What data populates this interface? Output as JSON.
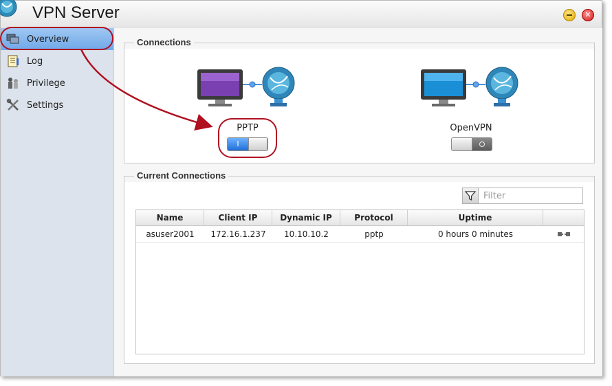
{
  "window": {
    "title": "VPN Server",
    "controls": {
      "minimize_icon": "minimize-icon",
      "close_icon": "close-icon",
      "close_glyph": "✕"
    }
  },
  "sidebar": {
    "items": [
      {
        "label": "Overview",
        "icon": "overview-icon",
        "active": true
      },
      {
        "label": "Log",
        "icon": "log-icon",
        "active": false
      },
      {
        "label": "Privilege",
        "icon": "privilege-icon",
        "active": false
      },
      {
        "label": "Settings",
        "icon": "settings-icon",
        "active": false
      }
    ]
  },
  "connections": {
    "title": "Connections",
    "services": [
      {
        "name": "PPTP",
        "enabled": true,
        "on_glyph": "I"
      },
      {
        "name": "OpenVPN",
        "enabled": false
      }
    ]
  },
  "current_connections": {
    "title": "Current Connections",
    "filter": {
      "placeholder": "Filter",
      "value": ""
    },
    "columns": [
      "Name",
      "Client IP",
      "Dynamic IP",
      "Protocol",
      "Uptime",
      ""
    ],
    "rows": [
      {
        "name": "asuser2001",
        "client_ip": "172.16.1.237",
        "dynamic_ip": "10.10.10.2",
        "protocol": "pptp",
        "uptime": "0 hours 0 minutes",
        "action_icon": "disconnect-icon"
      }
    ]
  },
  "colors": {
    "accent": "#6fa8e8",
    "annotation": "#b01020",
    "toggle_on": "#1f6fd8"
  }
}
